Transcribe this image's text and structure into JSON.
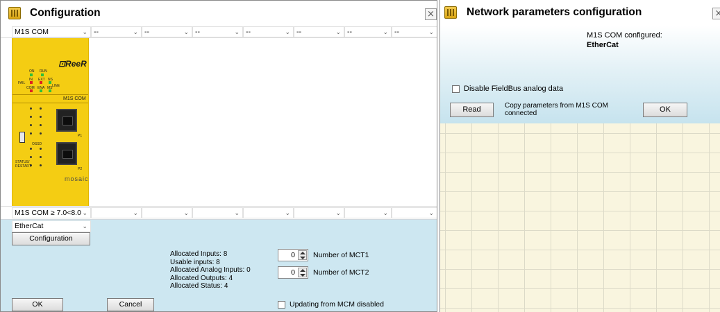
{
  "left_window": {
    "title": "Configuration",
    "close_glyph": "×",
    "slots_top": [
      "M1S COM",
      "--",
      "--",
      "--",
      "--",
      "--",
      "--",
      "--"
    ],
    "module": {
      "brand": "⊡ReeR",
      "name": "M1S COM",
      "footer": "mosaic",
      "led_labels": [
        "ON",
        "RUN",
        "FAIL",
        "IN",
        "EXT",
        "NS",
        "COM",
        "ENA",
        "MS",
        "LINE",
        "STATUS/",
        "RESTART",
        "OSSD",
        "P1",
        "P2"
      ],
      "colors": {
        "body": "#f4cd13",
        "led_green": "#2fbf3a",
        "led_red": "#e02020"
      }
    },
    "slots_bottom": [
      "M1S COM ≥ 7.0<8.0",
      "",
      "",
      "",
      "",
      "",
      "",
      ""
    ],
    "fieldbus_select": "EtherCat",
    "configuration_button": "Configuration",
    "info_lines": [
      "Allocated Inputs: 8",
      "Usable inputs: 8",
      "Allocated Analog Inputs: 0",
      "Allocated Outputs: 4",
      "Allocated Status: 4"
    ],
    "mct1": {
      "value": "0",
      "label": "Number of MCT1"
    },
    "mct2": {
      "value": "0",
      "label": "Number of MCT2"
    },
    "ok_button": "OK",
    "cancel_button": "Cancel",
    "updating_label": "Updating from MCM disabled",
    "updating_checked": false
  },
  "right_window": {
    "title": "Network parameters configuration",
    "close_glyph": "×",
    "configured_label": "M1S COM configured:",
    "configured_value": "EtherCat",
    "disable_analog_label": "Disable FieldBus analog data",
    "disable_analog_checked": false,
    "read_button": "Read",
    "copy_text": [
      "Copy parameters from M1S COM",
      "connected"
    ],
    "ok_button": "OK",
    "grid_color": "#f9f5df"
  }
}
